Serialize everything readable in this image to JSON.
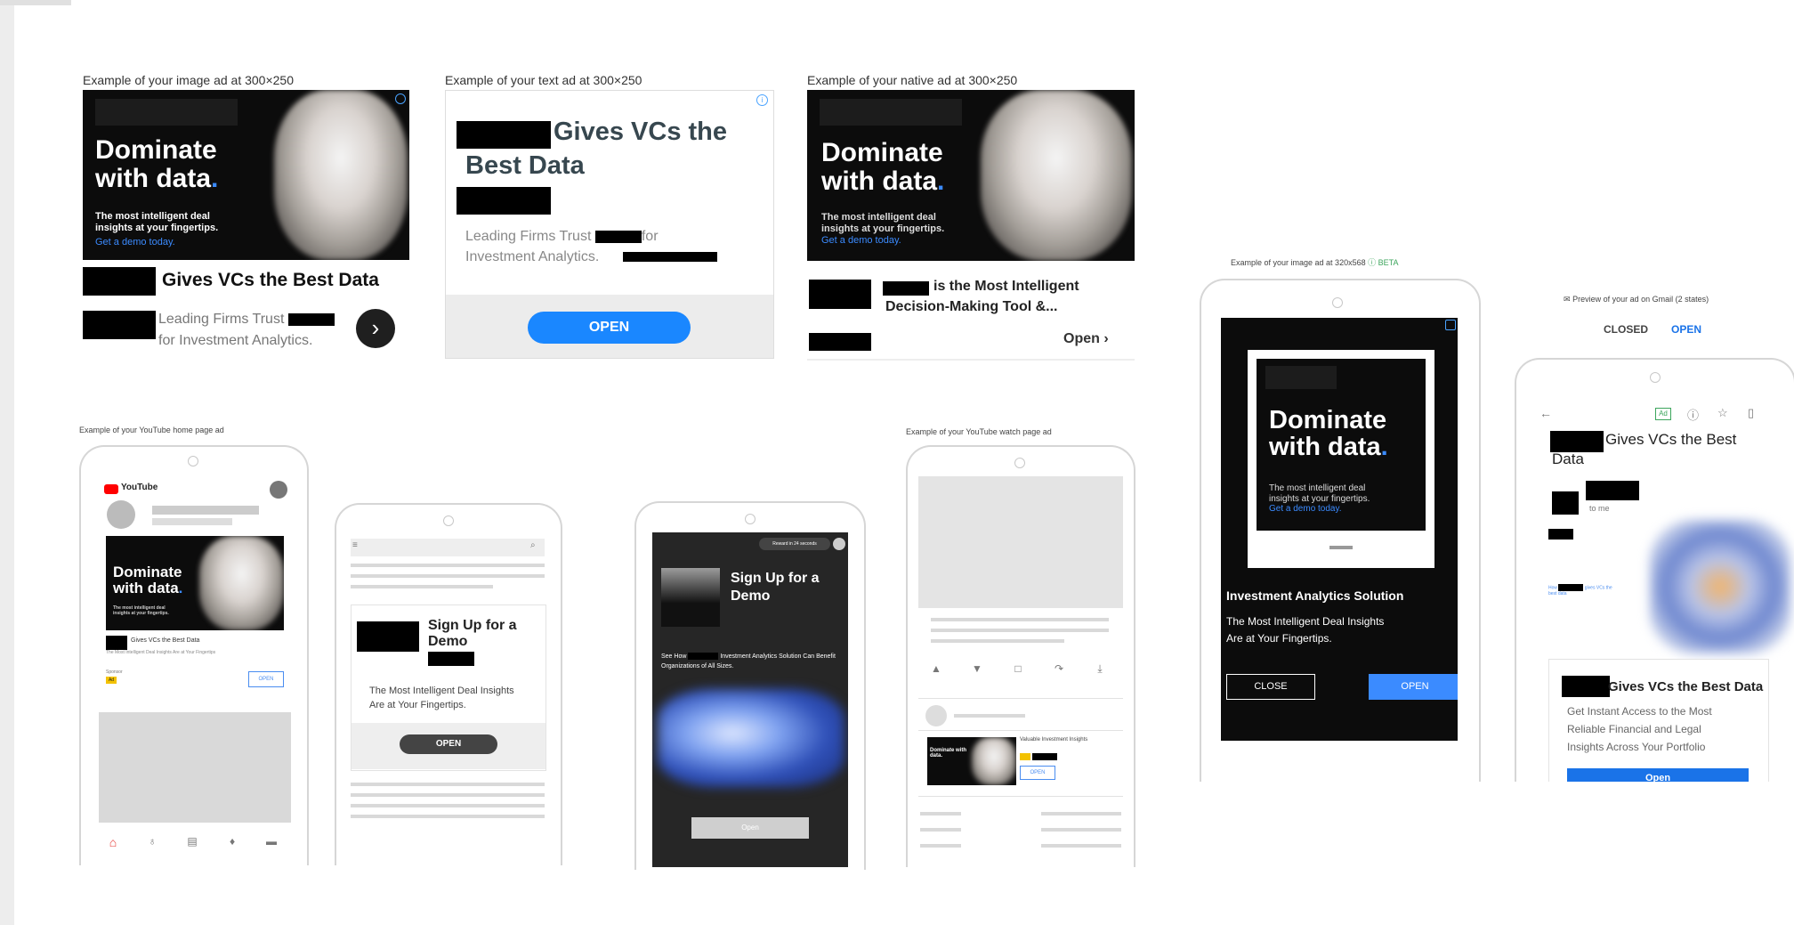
{
  "captions": {
    "image_ad": "Example of your image ad at 300×250",
    "text_ad": "Example of your text ad at 300×250",
    "native_ad": "Example of your native ad at 300×250",
    "youtube_home": "Example of your YouTube home page ad",
    "youtube_watch": "Example of your YouTube watch page ad",
    "image_320": "Example of your image ad at 320x568",
    "beta": "BETA",
    "gmail_preview": "Preview of your ad on Gmail (2 states)"
  },
  "ad": {
    "headline_part1": "Dominate",
    "headline_part2": "with data",
    "headline_dot": ".",
    "sub_line1": "The most intelligent deal",
    "sub_line2": "insights at your fingertips.",
    "cta_link": "Get a demo today."
  },
  "image_ad": {
    "title": "Gives VCs the Best Data",
    "desc_line1": "Leading Firms Trust",
    "desc_line2": "for Investment Analytics."
  },
  "text_ad": {
    "headline_a": "Gives VCs the",
    "headline_b": "Best Data",
    "desc_line1": "Leading Firms Trust",
    "desc_for": "for",
    "desc_line2": "Investment Analytics.",
    "open": "OPEN"
  },
  "native_ad": {
    "title_a": "is the Most Intelligent",
    "title_b": "Decision-Making Tool &...",
    "open": "Open"
  },
  "youtube_home": {
    "logo": "YouTube",
    "ad_title": "Gives VCs the Best Data",
    "ad_desc": "The Most Intelligent Deal Insights Are at Your Fingertips",
    "sponsor": "Sponsor",
    "badge": "Ad",
    "open": "OPEN"
  },
  "mobile_text": {
    "headline_a": "Sign Up for a",
    "headline_b": "Demo",
    "desc": "The Most Intelligent Deal Insights Are at Your Fingertips.",
    "open": "OPEN"
  },
  "video_ad": {
    "reward": "Reward in 24 seconds",
    "headline": "Sign Up for a Demo",
    "desc_a": "See How",
    "desc_b": "Investment Analytics Solution Can Benefit Organizations of All Sizes.",
    "open": "Open"
  },
  "youtube_watch": {
    "ad_title": "Valuable Investment Insights",
    "thumb_text": "Dominate with data.",
    "open": "OPEN"
  },
  "interstitial": {
    "title": "Investment Analytics Solution",
    "desc_a": "The Most Intelligent Deal Insights",
    "desc_b": "Are at Your Fingertips.",
    "close": "CLOSE",
    "open": "OPEN"
  },
  "gmail": {
    "tab_closed": "CLOSED",
    "tab_open": "OPEN",
    "subject_a": "Gives VCs the Best",
    "subject_b": "Data",
    "to_me": "to me",
    "card_title": "Gives VCs the Best Data",
    "card_desc_a": "Get Instant Access to the Most",
    "card_desc_b": "Reliable Financial and Legal",
    "card_desc_c": "Insights Across Your Portfolio",
    "open": "Open",
    "badge": "Ad"
  },
  "colors": {
    "accent_blue": "#1a73e8",
    "brand_dot": "#3b8bff",
    "youtube_red": "#ff0000",
    "dark_bg": "#0c0c0c"
  }
}
